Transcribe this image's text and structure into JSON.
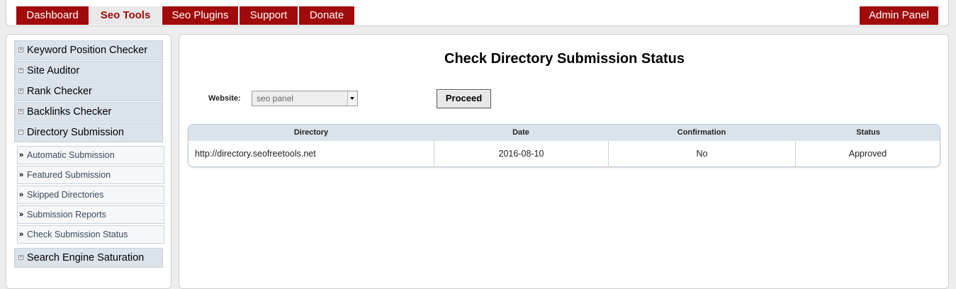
{
  "nav": {
    "tabs": [
      {
        "label": "Dashboard",
        "active": false
      },
      {
        "label": "Seo Tools",
        "active": true
      },
      {
        "label": "Seo Plugins",
        "active": false
      },
      {
        "label": "Support",
        "active": false
      },
      {
        "label": "Donate",
        "active": false
      }
    ],
    "admin_label": "Admin Panel"
  },
  "sidebar": {
    "items": [
      {
        "label": "Keyword Position Checker",
        "expanded": false
      },
      {
        "label": "Site Auditor",
        "expanded": false
      },
      {
        "label": "Rank Checker",
        "expanded": false
      },
      {
        "label": "Backlinks Checker",
        "expanded": false
      },
      {
        "label": "Directory Submission",
        "expanded": true
      },
      {
        "label": "Search Engine Saturation",
        "expanded": false
      }
    ],
    "subitems": [
      {
        "label": "Automatic Submission"
      },
      {
        "label": "Featured Submission"
      },
      {
        "label": "Skipped Directories"
      },
      {
        "label": "Submission Reports"
      },
      {
        "label": "Check Submission Status"
      }
    ],
    "expand_glyph": "+",
    "collapse_glyph": "−",
    "sub_arrow": "»"
  },
  "main": {
    "title": "Check Directory Submission Status",
    "website_label": "Website:",
    "website_selected": "seo panel",
    "proceed_label": "Proceed",
    "table": {
      "headers": [
        "Directory",
        "Date",
        "Confirmation",
        "Status"
      ],
      "rows": [
        [
          "http://directory.seofreetools.net",
          "2016-08-10",
          "No",
          "Approved"
        ]
      ]
    }
  },
  "colors": {
    "brand_red": "#a00a0a",
    "panel_header": "#dbe3ea",
    "background": "#ededed"
  }
}
